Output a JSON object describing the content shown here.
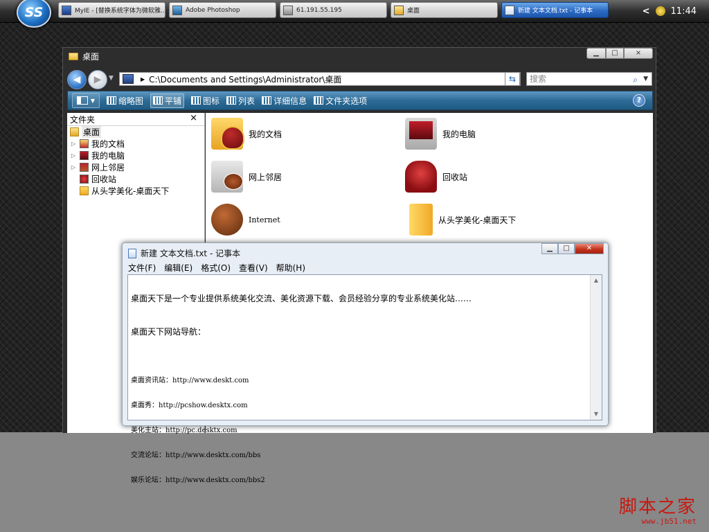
{
  "taskbar": {
    "start_label": "SS",
    "buttons": [
      {
        "label": "MyIE - [替换系统字体为微软雅...",
        "active": false
      },
      {
        "label": "Adobe Photoshop",
        "active": false
      },
      {
        "label": "61.191.55.195",
        "active": false
      },
      {
        "label": "桌面",
        "active": false
      },
      {
        "label": "新建 文本文档.txt - 记事本",
        "active": true
      }
    ],
    "tray_chevron": "<",
    "clock": "11:44"
  },
  "explorer": {
    "title": "桌面",
    "address": "C:\\Documents and Settings\\Administrator\\桌面",
    "search_placeholder": "搜索",
    "toolbar": [
      {
        "label": "缩略图"
      },
      {
        "label": "平铺"
      },
      {
        "label": "图标"
      },
      {
        "label": "列表"
      },
      {
        "label": "详细信息"
      },
      {
        "label": "文件夹选项"
      }
    ],
    "help_label": "?",
    "tree": {
      "header": "文件夹",
      "close": "×",
      "root": "桌面",
      "items": [
        {
          "label": "我的文档",
          "expandable": true
        },
        {
          "label": "我的电脑",
          "expandable": true
        },
        {
          "label": "网上邻居",
          "expandable": true
        },
        {
          "label": "回收站",
          "expandable": false
        },
        {
          "label": "从头学美化-桌面天下",
          "expandable": false
        }
      ]
    },
    "items": [
      {
        "label": "我的文档",
        "icon": "my-documents-icon"
      },
      {
        "label": "我的电脑",
        "icon": "my-computer-icon"
      },
      {
        "label": "网上邻居",
        "icon": "network-places-icon"
      },
      {
        "label": "回收站",
        "icon": "recycle-bin-icon"
      },
      {
        "label": "Internet",
        "icon": "internet-icon"
      },
      {
        "label": "从头学美化-桌面天下",
        "icon": "folder-icon"
      }
    ]
  },
  "notepad": {
    "title": "新建 文本文档.txt - 记事本",
    "menu": [
      "文件(F)",
      "编辑(E)",
      "格式(O)",
      "查看(V)",
      "帮助(H)"
    ],
    "lines": {
      "intro": "桌面天下是一个专业提供系统美化交流、美化资源下载、会员经验分享的专业系统美化站……",
      "nav_title": "桌面天下网站导航：",
      "links": [
        "桌面资讯站：http://www.deskt.com",
        "桌面秀：http://pcshow.desktx.com",
        "美化主站：http://pc.desktx.com",
        "交流论坛：http://www.desktx.com/bbs",
        "娱乐论坛：http://www.desktx.com/bbs2"
      ]
    }
  },
  "watermark": {
    "name": "脚本之家",
    "url": "www.jb51.net"
  }
}
